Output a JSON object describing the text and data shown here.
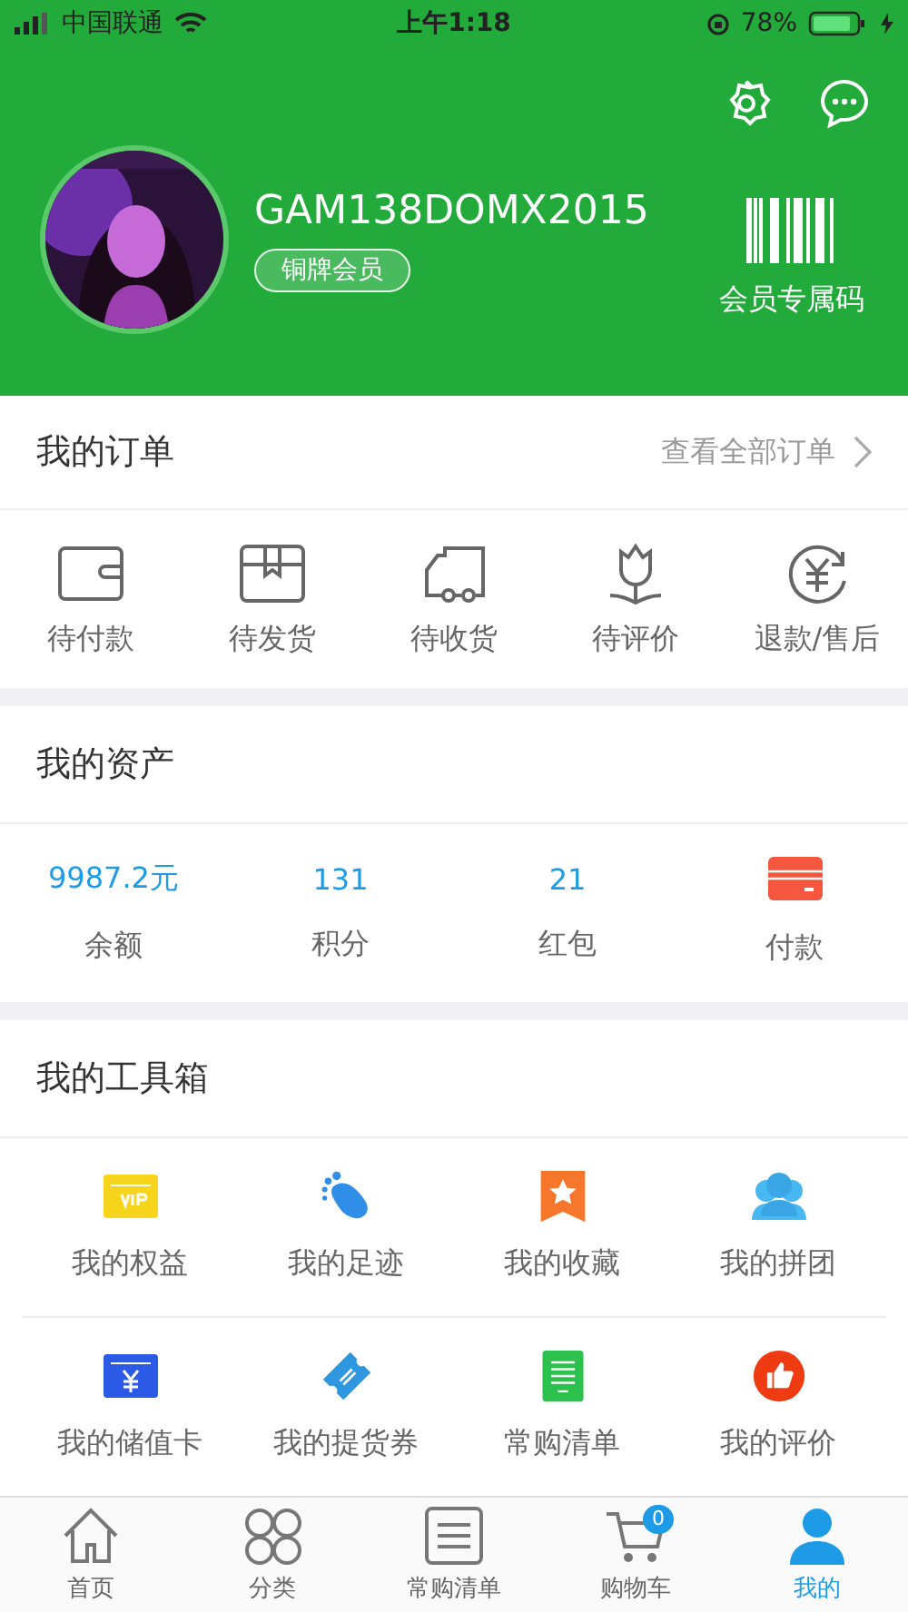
{
  "status_bar": {
    "carrier": "中国联通",
    "time": "上午1:18",
    "battery": "78%"
  },
  "profile": {
    "username": "GAM138DOMX2015",
    "badge": "铜牌会员",
    "code_label": "会员专属码"
  },
  "orders": {
    "title": "我的订单",
    "link": "查看全部订单",
    "items": [
      {
        "kind": "wallet",
        "label": "待付款"
      },
      {
        "kind": "box",
        "label": "待发货"
      },
      {
        "kind": "truck",
        "label": "待收货"
      },
      {
        "kind": "flower",
        "label": "待评价"
      },
      {
        "kind": "refund",
        "label": "退款/售后"
      }
    ]
  },
  "assets": {
    "title": "我的资产",
    "items": [
      {
        "kind": "value",
        "value": "9987.2元",
        "label": "余额"
      },
      {
        "kind": "value",
        "value": "131",
        "label": "积分"
      },
      {
        "kind": "value",
        "value": "21",
        "label": "红包"
      },
      {
        "kind": "card",
        "label": "付款"
      }
    ]
  },
  "toolbox": {
    "title": "我的工具箱",
    "items": [
      {
        "kind": "vip",
        "label": "我的权益"
      },
      {
        "kind": "foot",
        "label": "我的足迹"
      },
      {
        "kind": "star",
        "label": "我的收藏"
      },
      {
        "kind": "group",
        "label": "我的拼团"
      },
      {
        "kind": "yen",
        "label": "我的储值卡"
      },
      {
        "kind": "ticket",
        "label": "我的提货券"
      },
      {
        "kind": "list",
        "label": "常购清单"
      },
      {
        "kind": "thumb",
        "label": "我的评价"
      }
    ]
  },
  "tab_bar": [
    {
      "kind": "home",
      "label": "首页",
      "selected": false
    },
    {
      "kind": "grid",
      "label": "分类",
      "selected": false
    },
    {
      "kind": "list",
      "label": "常购清单",
      "selected": false
    },
    {
      "kind": "cart",
      "label": "购物车",
      "selected": false,
      "badge": "0"
    },
    {
      "kind": "person",
      "label": "我的",
      "selected": true
    }
  ]
}
